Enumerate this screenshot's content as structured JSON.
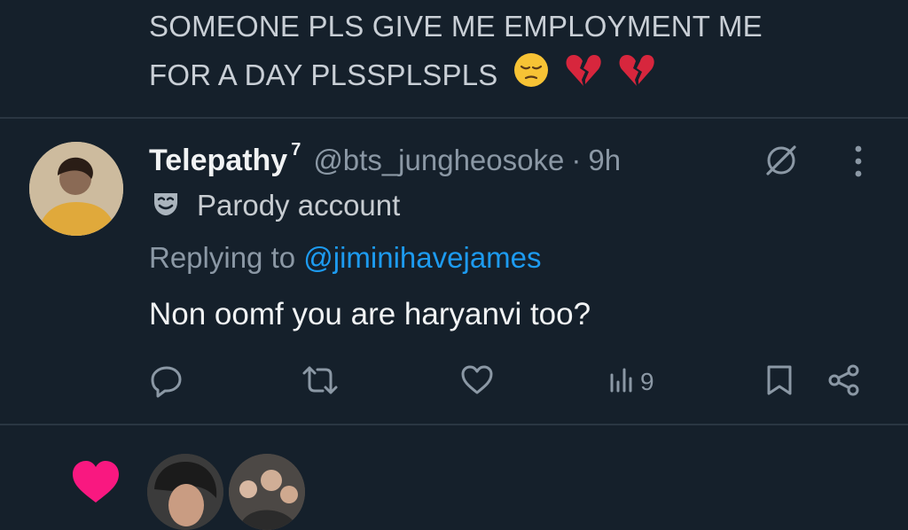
{
  "previous_tweet": {
    "text_line1": "SOMEONE PLS GIVE ME EMPLOYMENT ME",
    "text_line2": "FOR A DAY PLSSPLSPLS",
    "emojis": [
      "pensive-face",
      "broken-heart",
      "broken-heart"
    ]
  },
  "reply": {
    "display_name": "Telepathy",
    "superscript": "7",
    "handle": "@bts_jungheosoke",
    "separator": "·",
    "time": "9h",
    "parody_label": "Parody account",
    "replying_prefix": "Replying to ",
    "replying_to": "@jiminihavejames",
    "text": "Non oomf you are haryanvi too?",
    "actions": {
      "reply_icon": "reply-icon",
      "retweet_icon": "retweet-icon",
      "like_icon": "heart-icon",
      "views_icon": "views-icon",
      "views_count": "9",
      "bookmark_icon": "bookmark-icon",
      "share_icon": "share-icon"
    }
  },
  "colors": {
    "background": "#15202b",
    "link": "#1d9bf0",
    "muted": "#8b98a5",
    "like_pink": "#f91880"
  }
}
